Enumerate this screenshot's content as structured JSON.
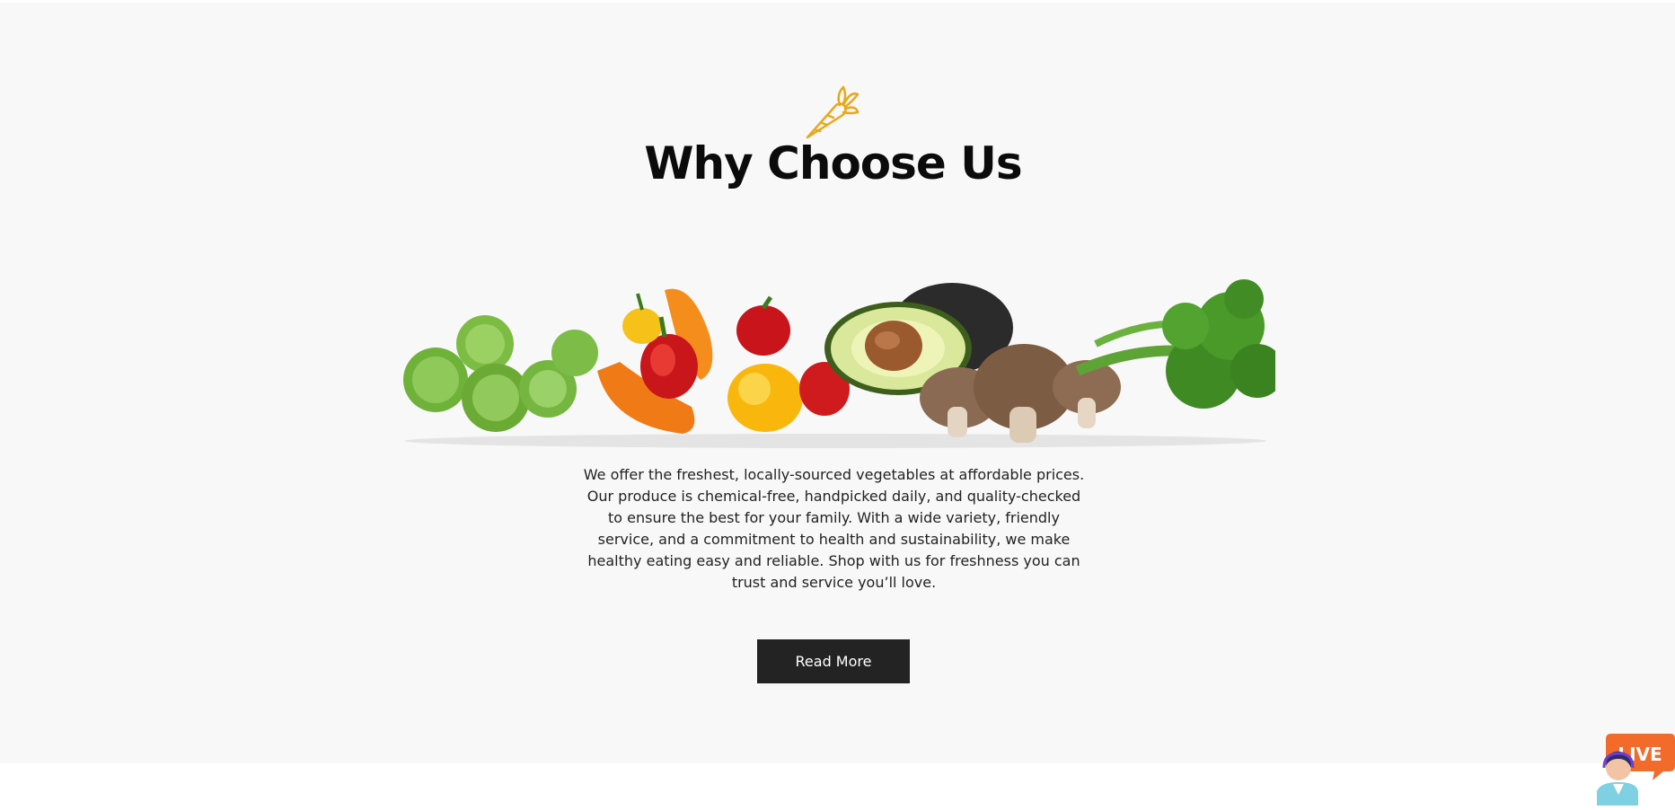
{
  "section": {
    "icon": "carrot-icon",
    "title": "Why Choose Us",
    "image_alt": "vegetables",
    "description": "We offer the freshest, locally-sourced vegetables at affordable prices. Our produce is chemical-free, handpicked daily, and quality-checked to ensure the best for your family. With a wide variety, friendly service, and a commitment to health and sustainability, we make healthy eating easy and reliable. Shop with us for freshness you can trust and service you’ll love.",
    "button_label": "Read More"
  },
  "live_widget": {
    "badge": "LIVE",
    "icon": "support-agent-icon"
  },
  "colors": {
    "section_bg": "#f8f8f8",
    "accent": "#e9a81a",
    "button_bg": "#232323",
    "live_orange": "#f26b2b"
  }
}
